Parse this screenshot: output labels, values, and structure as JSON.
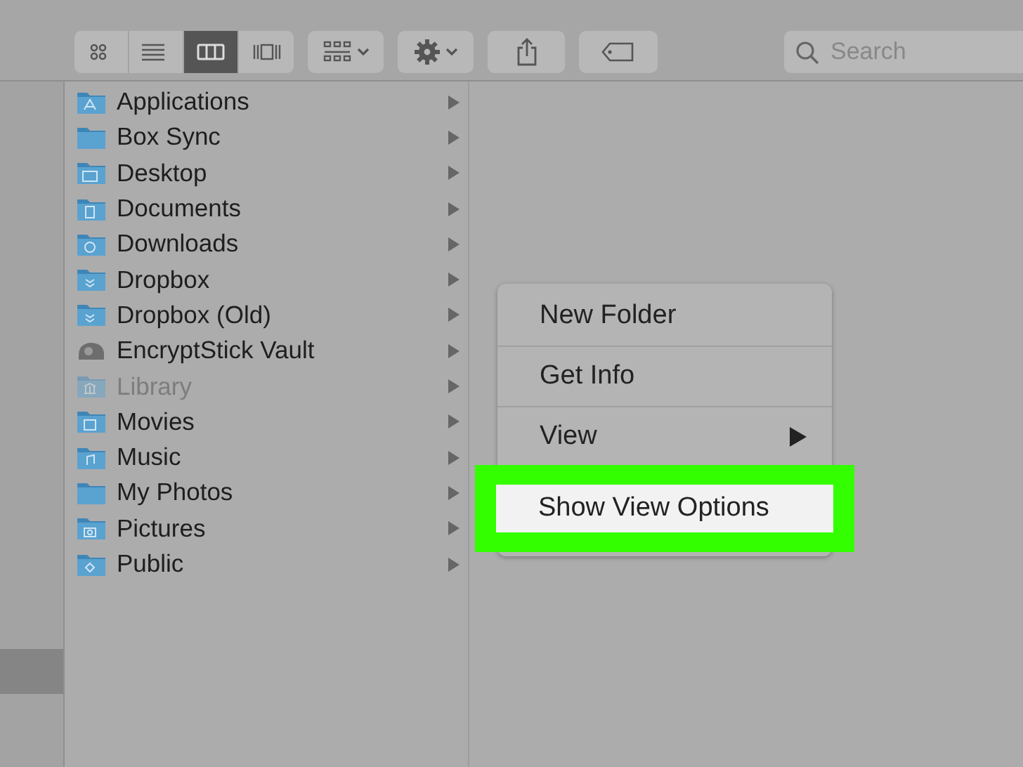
{
  "toolbar": {
    "view_buttons": [
      {
        "kind": "icons",
        "selected": false
      },
      {
        "kind": "list",
        "selected": false
      },
      {
        "kind": "columns",
        "selected": true
      },
      {
        "kind": "coverflow",
        "selected": false
      }
    ],
    "search": {
      "placeholder": "Search"
    }
  },
  "column": {
    "items": [
      {
        "label": "Applications",
        "kind": "folder",
        "disabled": false
      },
      {
        "label": "Box Sync",
        "kind": "folder",
        "disabled": false
      },
      {
        "label": "Desktop",
        "kind": "folder",
        "disabled": false
      },
      {
        "label": "Documents",
        "kind": "folder",
        "disabled": false
      },
      {
        "label": "Downloads",
        "kind": "folder",
        "disabled": false
      },
      {
        "label": "Dropbox",
        "kind": "folder",
        "disabled": false
      },
      {
        "label": "Dropbox (Old)",
        "kind": "folder",
        "disabled": false
      },
      {
        "label": "EncryptStick Vault",
        "kind": "drive",
        "disabled": false
      },
      {
        "label": "Library",
        "kind": "folder",
        "disabled": true
      },
      {
        "label": "Movies",
        "kind": "folder",
        "disabled": false
      },
      {
        "label": "Music",
        "kind": "folder",
        "disabled": false
      },
      {
        "label": "My Photos",
        "kind": "folder",
        "disabled": false
      },
      {
        "label": "Pictures",
        "kind": "folder",
        "disabled": false
      },
      {
        "label": "Public",
        "kind": "folder",
        "disabled": false
      }
    ]
  },
  "context_menu": {
    "items": [
      {
        "kind": "item",
        "label": "New Folder",
        "selected": false
      },
      {
        "kind": "separator"
      },
      {
        "kind": "item",
        "label": "Get Info",
        "selected": false
      },
      {
        "kind": "separator"
      },
      {
        "kind": "submenu",
        "label": "View",
        "selected": false
      },
      {
        "kind": "item",
        "label": "Show View Options",
        "selected": true
      }
    ]
  }
}
